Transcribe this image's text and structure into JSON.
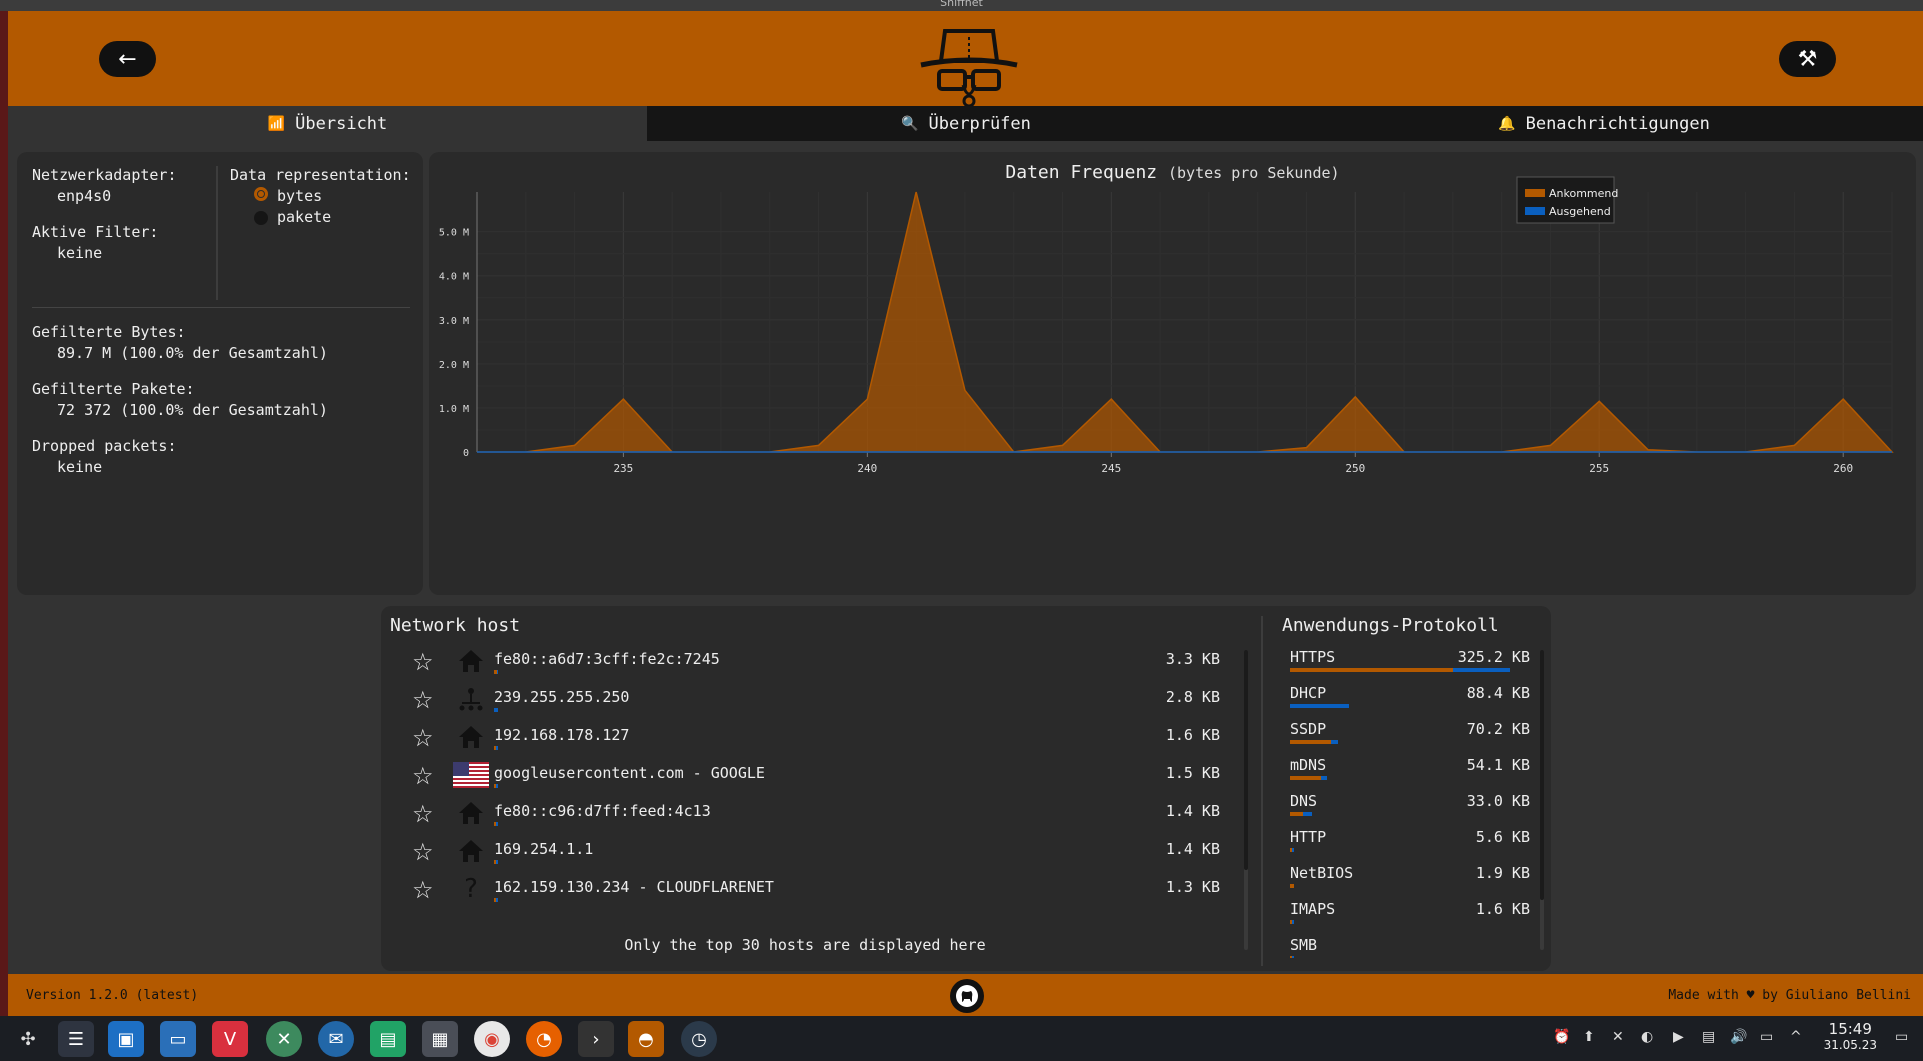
{
  "window": {
    "title": "Sniffnet"
  },
  "header": {
    "back_icon": "←",
    "settings_icon": "⚒"
  },
  "tabs": [
    {
      "label": "Übersicht",
      "icon": "chart-icon",
      "glyph": "📶"
    },
    {
      "label": "Überprüfen",
      "icon": "zoom-icon",
      "glyph": "🔍"
    },
    {
      "label": "Benachrichtigungen",
      "icon": "bell-icon",
      "glyph": "🔔"
    }
  ],
  "overview": {
    "adapter_label": "Netzwerkadapter:",
    "adapter_value": "enp4s0",
    "filters_label": "Aktive Filter:",
    "filters_value": "keine",
    "representation_label": "Data representation:",
    "option_bytes": "bytes",
    "option_packets": "pakete",
    "selected": "bytes",
    "bytes_label": "Gefilterte Bytes:",
    "bytes_value": "89.7 M (100.0% der Gesamtzahl)",
    "packets_label": "Gefilterte Pakete:",
    "packets_value": "72 372 (100.0% der Gesamtzahl)",
    "dropped_label": "Dropped packets:",
    "dropped_value": "keine"
  },
  "chart_data": {
    "type": "area",
    "title": "Daten Frequenz",
    "subtitle": "(bytes pro Sekunde)",
    "x": [
      232,
      233,
      234,
      235,
      236,
      237,
      238,
      239,
      240,
      241,
      242,
      243,
      244,
      245,
      246,
      247,
      248,
      249,
      250,
      251,
      252,
      253,
      254,
      255,
      256,
      257,
      258,
      259,
      260,
      261
    ],
    "xticks": [
      235,
      240,
      245,
      250,
      255,
      260
    ],
    "yticks": [
      0,
      1000000,
      2000000,
      3000000,
      4000000,
      5000000
    ],
    "ytick_labels": [
      "0",
      "1.0 M",
      "2.0 M",
      "3.0 M",
      "4.0 M",
      "5.0 M"
    ],
    "xlim": [
      232,
      261
    ],
    "ylim": [
      0,
      5900000
    ],
    "series": [
      {
        "name": "Ankommend",
        "color": "#b35900",
        "values": [
          0,
          0,
          150000,
          1200000,
          0,
          0,
          0,
          150000,
          1200000,
          5900000,
          1400000,
          0,
          150000,
          1200000,
          0,
          0,
          0,
          100000,
          1250000,
          0,
          0,
          0,
          150000,
          1150000,
          50000,
          0,
          0,
          150000,
          1200000,
          0
        ]
      },
      {
        "name": "Ausgehend",
        "color": "#0a5fbf",
        "values": [
          0,
          0,
          0,
          0,
          0,
          0,
          0,
          0,
          0,
          0,
          0,
          0,
          0,
          0,
          0,
          0,
          0,
          0,
          0,
          0,
          0,
          0,
          0,
          0,
          0,
          0,
          0,
          0,
          0,
          0
        ]
      }
    ],
    "legend": "top-right",
    "grid": true
  },
  "hosts": {
    "title": "Network host",
    "footer": "Only the top 30 hosts are displayed here",
    "items": [
      {
        "name": "fe80::a6d7:3cff:fe2c:7245",
        "size": "3.3 KB",
        "icon": "home-icon",
        "glyph": "🏠",
        "in": 0.7
      },
      {
        "name": "239.255.255.250",
        "size": "2.8 KB",
        "icon": "multicast-icon",
        "glyph": "⛶",
        "in": 0.0
      },
      {
        "name": "192.168.178.127",
        "size": "1.6 KB",
        "icon": "home-icon",
        "glyph": "🏠",
        "in": 0.4
      },
      {
        "name": "googleusercontent.com - GOOGLE",
        "size": "1.5 KB",
        "icon": "us-flag-icon",
        "glyph": "",
        "in": 0.5
      },
      {
        "name": "fe80::c96:d7ff:feed:4c13",
        "size": "1.4 KB",
        "icon": "home-icon",
        "glyph": "🏠",
        "in": 0.6
      },
      {
        "name": "169.254.1.1",
        "size": "1.4 KB",
        "icon": "home-icon",
        "glyph": "🏠",
        "in": 0.6
      },
      {
        "name": "162.159.130.234 - CLOUDFLARENET",
        "size": "1.3 KB",
        "icon": "unknown-icon",
        "glyph": "?",
        "in": 0.5
      }
    ]
  },
  "protocols": {
    "title": "Anwendungs-Protokoll",
    "items": [
      {
        "name": "HTTPS",
        "size": "325.2 KB",
        "in": 0.74,
        "out": 0.26,
        "scale": 1.0
      },
      {
        "name": "DHCP",
        "size": "88.4 KB",
        "in": 0.0,
        "out": 1.0,
        "scale": 0.27
      },
      {
        "name": "SSDP",
        "size": "70.2 KB",
        "in": 0.85,
        "out": 0.15,
        "scale": 0.22
      },
      {
        "name": "mDNS",
        "size": "54.1 KB",
        "in": 0.85,
        "out": 0.15,
        "scale": 0.17
      },
      {
        "name": "DNS",
        "size": "33.0 KB",
        "in": 0.6,
        "out": 0.4,
        "scale": 0.1
      },
      {
        "name": "HTTP",
        "size": "5.6 KB",
        "in": 0.6,
        "out": 0.4,
        "scale": 0.02
      },
      {
        "name": "NetBIOS",
        "size": "1.9 KB",
        "in": 1.0,
        "out": 0.0,
        "scale": 0.01
      },
      {
        "name": "IMAPS",
        "size": "1.6 KB",
        "in": 0.5,
        "out": 0.5,
        "scale": 0.01
      },
      {
        "name": "SMB",
        "size": "",
        "in": 0.5,
        "out": 0.5,
        "scale": 0.0
      }
    ]
  },
  "footer": {
    "version": "Version 1.2.0 (latest)",
    "made_with": "Made with ♥ by Giuliano Bellini"
  },
  "taskbar": {
    "time": "15:49",
    "date": "31.05.23"
  },
  "colors": {
    "accent": "#b35900",
    "incoming": "#b35900",
    "outgoing": "#0a5fbf"
  }
}
